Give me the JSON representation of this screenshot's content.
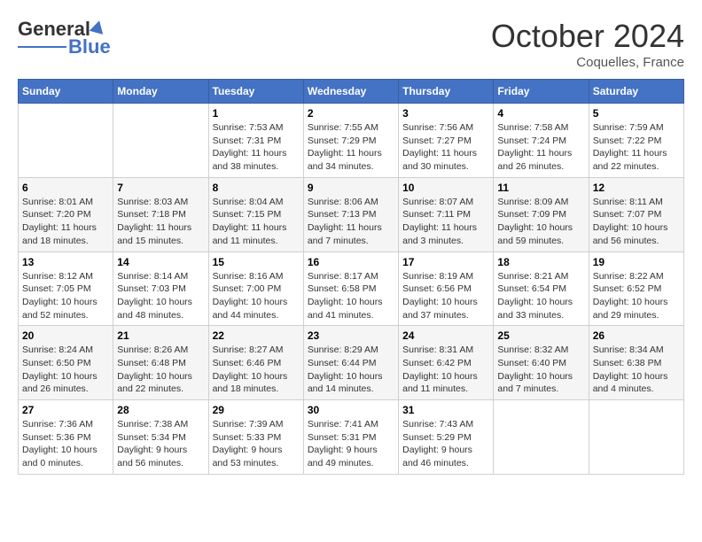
{
  "header": {
    "logo_general": "General",
    "logo_blue": "Blue",
    "month": "October 2024",
    "location": "Coquelles, France"
  },
  "days_of_week": [
    "Sunday",
    "Monday",
    "Tuesday",
    "Wednesday",
    "Thursday",
    "Friday",
    "Saturday"
  ],
  "weeks": [
    [
      {
        "day": "",
        "info": ""
      },
      {
        "day": "",
        "info": ""
      },
      {
        "day": "1",
        "info": "Sunrise: 7:53 AM\nSunset: 7:31 PM\nDaylight: 11 hours and 38 minutes."
      },
      {
        "day": "2",
        "info": "Sunrise: 7:55 AM\nSunset: 7:29 PM\nDaylight: 11 hours and 34 minutes."
      },
      {
        "day": "3",
        "info": "Sunrise: 7:56 AM\nSunset: 7:27 PM\nDaylight: 11 hours and 30 minutes."
      },
      {
        "day": "4",
        "info": "Sunrise: 7:58 AM\nSunset: 7:24 PM\nDaylight: 11 hours and 26 minutes."
      },
      {
        "day": "5",
        "info": "Sunrise: 7:59 AM\nSunset: 7:22 PM\nDaylight: 11 hours and 22 minutes."
      }
    ],
    [
      {
        "day": "6",
        "info": "Sunrise: 8:01 AM\nSunset: 7:20 PM\nDaylight: 11 hours and 18 minutes."
      },
      {
        "day": "7",
        "info": "Sunrise: 8:03 AM\nSunset: 7:18 PM\nDaylight: 11 hours and 15 minutes."
      },
      {
        "day": "8",
        "info": "Sunrise: 8:04 AM\nSunset: 7:15 PM\nDaylight: 11 hours and 11 minutes."
      },
      {
        "day": "9",
        "info": "Sunrise: 8:06 AM\nSunset: 7:13 PM\nDaylight: 11 hours and 7 minutes."
      },
      {
        "day": "10",
        "info": "Sunrise: 8:07 AM\nSunset: 7:11 PM\nDaylight: 11 hours and 3 minutes."
      },
      {
        "day": "11",
        "info": "Sunrise: 8:09 AM\nSunset: 7:09 PM\nDaylight: 10 hours and 59 minutes."
      },
      {
        "day": "12",
        "info": "Sunrise: 8:11 AM\nSunset: 7:07 PM\nDaylight: 10 hours and 56 minutes."
      }
    ],
    [
      {
        "day": "13",
        "info": "Sunrise: 8:12 AM\nSunset: 7:05 PM\nDaylight: 10 hours and 52 minutes."
      },
      {
        "day": "14",
        "info": "Sunrise: 8:14 AM\nSunset: 7:03 PM\nDaylight: 10 hours and 48 minutes."
      },
      {
        "day": "15",
        "info": "Sunrise: 8:16 AM\nSunset: 7:00 PM\nDaylight: 10 hours and 44 minutes."
      },
      {
        "day": "16",
        "info": "Sunrise: 8:17 AM\nSunset: 6:58 PM\nDaylight: 10 hours and 41 minutes."
      },
      {
        "day": "17",
        "info": "Sunrise: 8:19 AM\nSunset: 6:56 PM\nDaylight: 10 hours and 37 minutes."
      },
      {
        "day": "18",
        "info": "Sunrise: 8:21 AM\nSunset: 6:54 PM\nDaylight: 10 hours and 33 minutes."
      },
      {
        "day": "19",
        "info": "Sunrise: 8:22 AM\nSunset: 6:52 PM\nDaylight: 10 hours and 29 minutes."
      }
    ],
    [
      {
        "day": "20",
        "info": "Sunrise: 8:24 AM\nSunset: 6:50 PM\nDaylight: 10 hours and 26 minutes."
      },
      {
        "day": "21",
        "info": "Sunrise: 8:26 AM\nSunset: 6:48 PM\nDaylight: 10 hours and 22 minutes."
      },
      {
        "day": "22",
        "info": "Sunrise: 8:27 AM\nSunset: 6:46 PM\nDaylight: 10 hours and 18 minutes."
      },
      {
        "day": "23",
        "info": "Sunrise: 8:29 AM\nSunset: 6:44 PM\nDaylight: 10 hours and 14 minutes."
      },
      {
        "day": "24",
        "info": "Sunrise: 8:31 AM\nSunset: 6:42 PM\nDaylight: 10 hours and 11 minutes."
      },
      {
        "day": "25",
        "info": "Sunrise: 8:32 AM\nSunset: 6:40 PM\nDaylight: 10 hours and 7 minutes."
      },
      {
        "day": "26",
        "info": "Sunrise: 8:34 AM\nSunset: 6:38 PM\nDaylight: 10 hours and 4 minutes."
      }
    ],
    [
      {
        "day": "27",
        "info": "Sunrise: 7:36 AM\nSunset: 5:36 PM\nDaylight: 10 hours and 0 minutes."
      },
      {
        "day": "28",
        "info": "Sunrise: 7:38 AM\nSunset: 5:34 PM\nDaylight: 9 hours and 56 minutes."
      },
      {
        "day": "29",
        "info": "Sunrise: 7:39 AM\nSunset: 5:33 PM\nDaylight: 9 hours and 53 minutes."
      },
      {
        "day": "30",
        "info": "Sunrise: 7:41 AM\nSunset: 5:31 PM\nDaylight: 9 hours and 49 minutes."
      },
      {
        "day": "31",
        "info": "Sunrise: 7:43 AM\nSunset: 5:29 PM\nDaylight: 9 hours and 46 minutes."
      },
      {
        "day": "",
        "info": ""
      },
      {
        "day": "",
        "info": ""
      }
    ]
  ]
}
